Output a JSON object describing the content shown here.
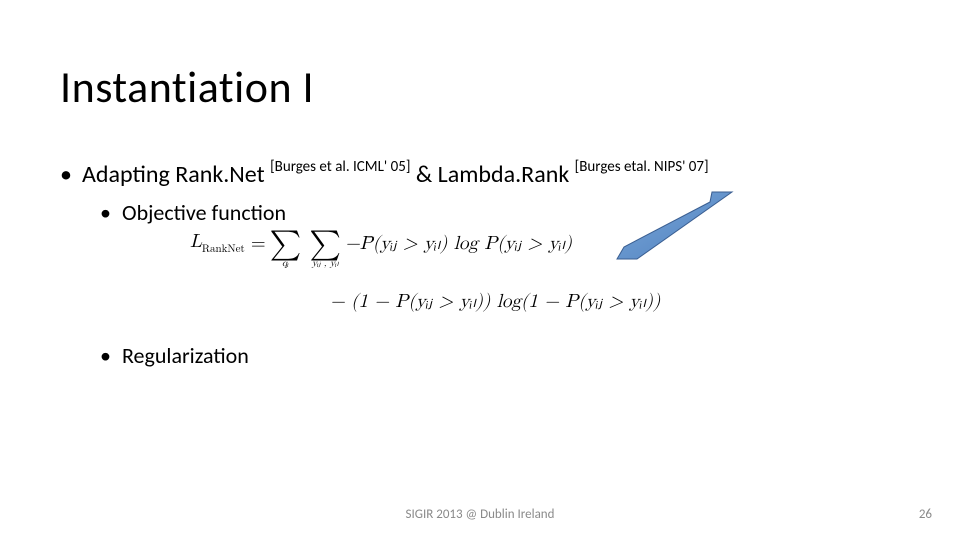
{
  "title": "Instantiation I",
  "bullets": {
    "main": {
      "prefix": "Adapting Rank.Net ",
      "cite1": "[Burges et al. ICML' 05]",
      "mid": " & Lambda.Rank ",
      "cite2": "[Burges etal. NIPS' 07]"
    },
    "sub1": "Objective function",
    "sub2": "Regularization"
  },
  "equation": {
    "lhs": "L",
    "lhs_sub": "RankNet",
    "eq": " = ",
    "sum1_below": "qᵢ",
    "sum2_below": "yᵢⱼ , yᵢₗ",
    "row1_rhs": " −P̄(yᵢⱼ > yᵢₗ) log P(yᵢⱼ > yᵢₗ)",
    "row2": "− (1 − P(yᵢⱼ > yᵢₗ)) log(1 − P(yᵢⱼ > yᵢₗ))"
  },
  "footer": {
    "center": "SIGIR 2013 @ Dublin Ireland",
    "page": "26"
  }
}
